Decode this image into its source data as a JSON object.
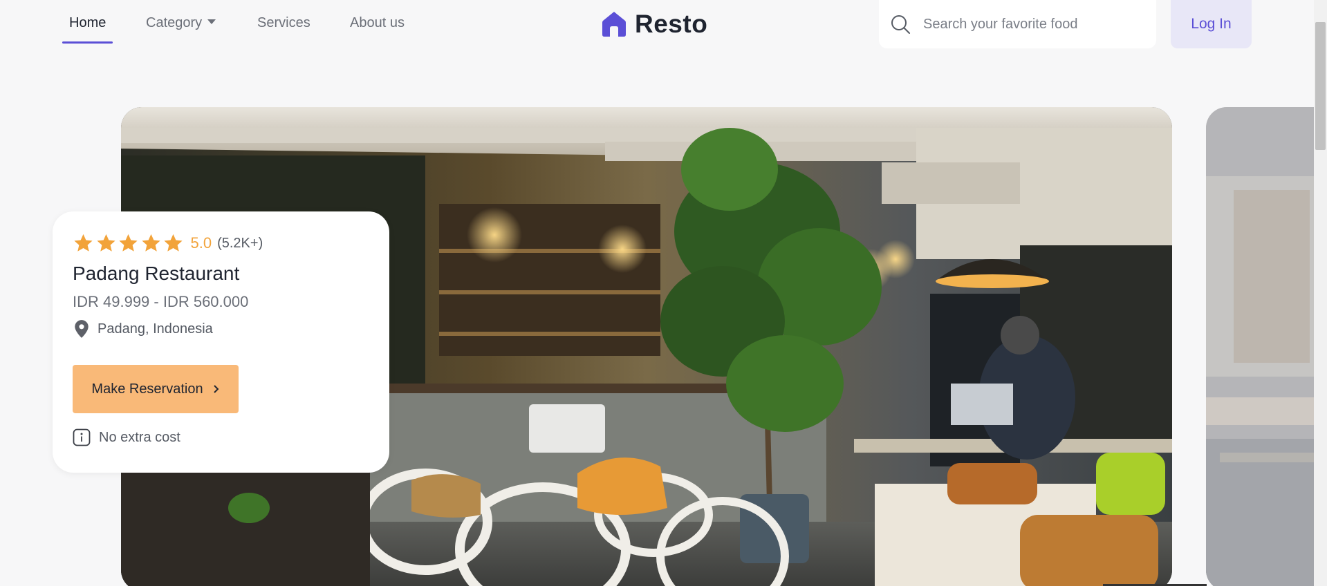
{
  "nav": {
    "links": [
      "Home",
      "Category",
      "Services",
      "About us"
    ],
    "brand": "Resto",
    "search_placeholder": "Search your favorite food",
    "login_label": "Log In"
  },
  "hero": {
    "card": {
      "rating_value": "5.0",
      "rating_count": "(5.2K+)",
      "stars": 5,
      "title": "Padang Restaurant",
      "price_range": "IDR 49.999 - IDR 560.000",
      "location": "Padang, Indonesia",
      "cta_label": "Make Reservation",
      "note": "No extra cost"
    }
  },
  "colors": {
    "accent": "#5b4fd6",
    "cta": "#f9b978",
    "star": "#f2a33a"
  },
  "icons": [
    "home-logo-icon",
    "search-icon",
    "star-icon",
    "location-pin-icon",
    "chevron-right-icon",
    "info-icon"
  ]
}
